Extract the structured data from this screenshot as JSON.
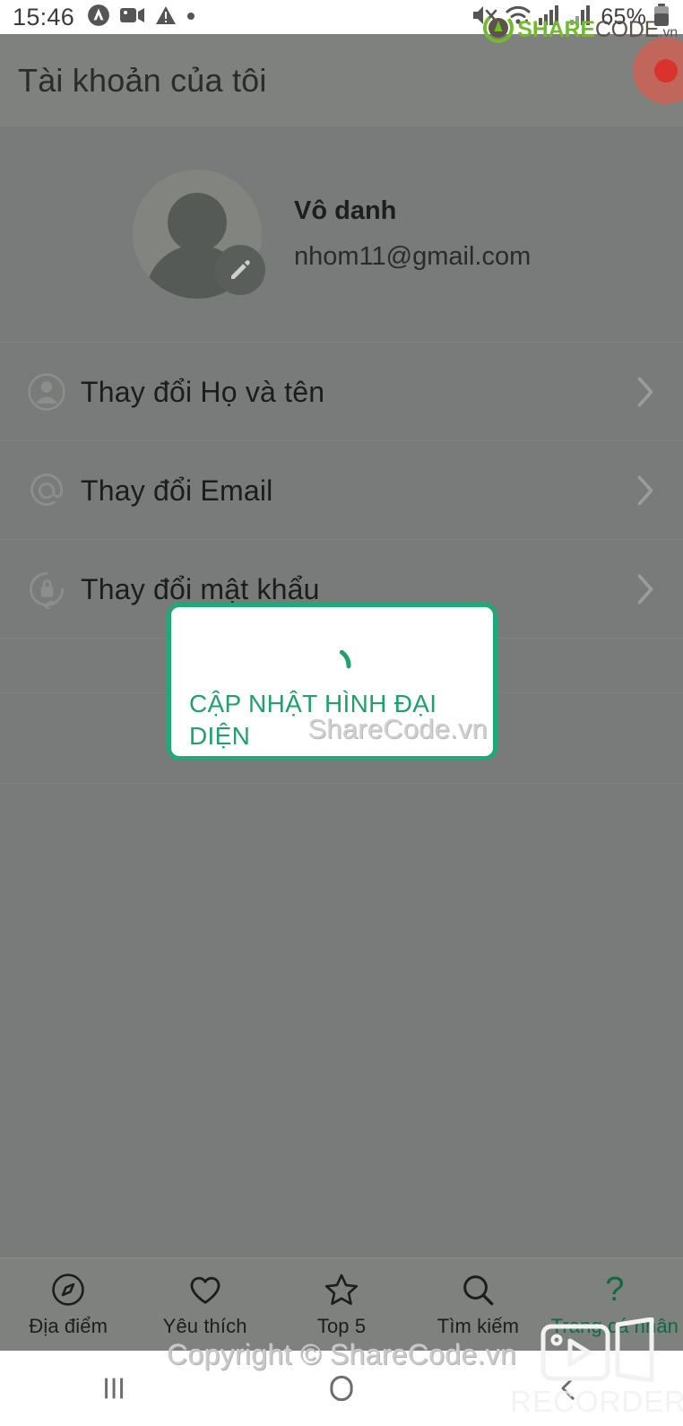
{
  "status_bar": {
    "clock": "15:46",
    "battery_percent": "65%",
    "icons": [
      "assistant-icon",
      "screen-recorder-icon",
      "warning-icon",
      "dot-icon"
    ],
    "right_icons": [
      "mute-icon",
      "wifi-icon",
      "signal-sim1-icon",
      "signal-sim2-icon",
      "battery-icon"
    ]
  },
  "branding": {
    "logo_share": "SHARE",
    "logo_code": "CODE",
    "logo_tld": ".vn",
    "copyright": "Copyright © ShareCode.vn",
    "dialog_watermark": "ShareCode.vn",
    "recorder_label": "RECORDER"
  },
  "app_bar": {
    "title": "Tài khoản của tôi"
  },
  "profile": {
    "name": "Vô danh",
    "email": "nhom11@gmail.com",
    "avatar_icon": "person-avatar-icon",
    "edit_badge_icon": "pencil-icon"
  },
  "settings_list": [
    {
      "label": "Thay đổi Họ và tên",
      "icon": "person-circle-icon",
      "chevron": "chevron-right-icon"
    },
    {
      "label": "Thay đổi Email",
      "icon": "at-sign-icon",
      "chevron": "chevron-right-icon"
    },
    {
      "label": "Thay đổi mật khẩu",
      "icon": "lock-reset-icon",
      "chevron": "chevron-right-icon"
    }
  ],
  "dialog": {
    "message": "CẬP NHẬT HÌNH ĐẠI DIỆN",
    "spinner_icon": "loading-spinner-icon",
    "border_color": "#20a877",
    "text_color": "#21a06b"
  },
  "bottom_nav": {
    "items": [
      {
        "label": "Địa điểm",
        "icon": "compass-icon",
        "active": false
      },
      {
        "label": "Yêu thích",
        "icon": "heart-icon",
        "active": false
      },
      {
        "label": "Top 5",
        "icon": "star-icon",
        "active": false
      },
      {
        "label": "Tìm kiếm",
        "icon": "search-icon",
        "active": false
      },
      {
        "label": "Trang cá nhân",
        "icon": "question-mark-icon",
        "active": true
      }
    ],
    "active_color": "#0e6b3f"
  },
  "system_nav": {
    "recents": "recents-icon",
    "home": "home-icon",
    "back": "back-icon"
  },
  "colors": {
    "scrim": "#787b79",
    "app_bar": "#7e817e",
    "accent_green": "#20a877",
    "record_dot": "#d9332b"
  }
}
